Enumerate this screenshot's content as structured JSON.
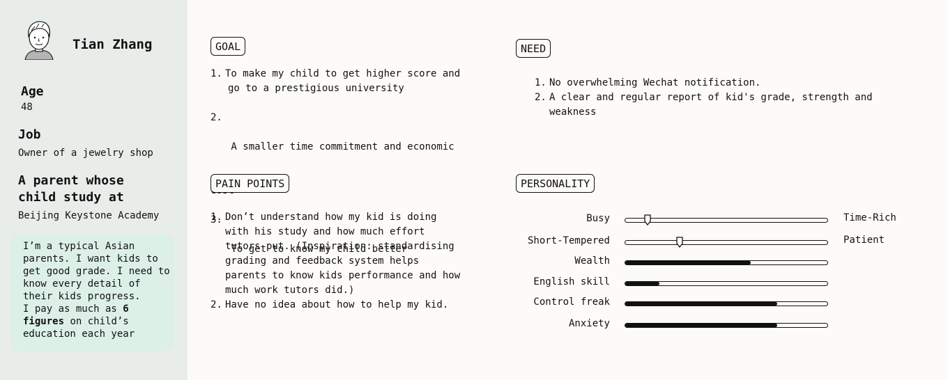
{
  "persona": {
    "name": "Tian Zhang",
    "age_label": "Age",
    "age": "48",
    "job_label": "Job",
    "job": "Owner of a jewelry shop",
    "parent_label_line1": "A parent whose",
    "parent_label_line2": "child study at",
    "school": "Beijing Keystone Academy",
    "quote_lines": [
      "I’m a typical Asian",
      "parents. I want kids to",
      "get good grade. I need to",
      "know every detail of",
      "their kids progress."
    ],
    "quote_pay_prefix": "I pay as much as ",
    "quote_pay_bold1": "6",
    "quote_pay_bold2": "figures",
    "quote_pay_suffix": " on child’s",
    "quote_last": "education each year"
  },
  "goal": {
    "tag": "GOAL",
    "items": [
      {
        "n": "1.",
        "lines": [
          "To make my child to get higher score and",
          "go to a prestigious university"
        ]
      },
      {
        "n": "2.",
        "lines": [
          " A smaller time commitment and economic"
        ],
        "cont": "cost"
      },
      {
        "n": "3.",
        "lines": [
          " To get to know my child better"
        ]
      }
    ]
  },
  "need": {
    "tag": "NEED",
    "items": [
      {
        "n": "1.",
        "lines": [
          "No overwhelming Wechat notification."
        ]
      },
      {
        "n": "2.",
        "lines": [
          "A clear and regular report of kid's grade, strength and",
          "weakness"
        ]
      }
    ]
  },
  "pain_points": {
    "tag": "PAIN POINTS",
    "items": [
      {
        "n": "1.",
        "lines": [
          "Don’t understand how my kid is doing",
          "with his study and how much effort",
          "tutors put. (Inspiration: standardising",
          "grading and feedback system helps",
          "parents to know kids performance and how",
          "much work tutors did.)"
        ]
      },
      {
        "n": "2.",
        "lines": [
          "Have no idea about how to help my kid."
        ]
      }
    ]
  },
  "personality": {
    "tag": "PERSONALITY",
    "sliders": [
      {
        "left": "Busy",
        "right": "Time-Rich",
        "value": 0.11,
        "kind": "thumb"
      },
      {
        "left": "Short-Tempered",
        "right": "Patient",
        "value": 0.27,
        "kind": "thumb"
      },
      {
        "left": "Wealth",
        "right": "",
        "value": 0.62,
        "kind": "bar"
      },
      {
        "left": "English skill",
        "right": "",
        "value": 0.17,
        "kind": "bar"
      },
      {
        "left": "Control freak",
        "right": "",
        "value": 0.75,
        "kind": "bar"
      },
      {
        "left": "Anxiety",
        "right": "",
        "value": 0.75,
        "kind": "bar"
      }
    ]
  }
}
